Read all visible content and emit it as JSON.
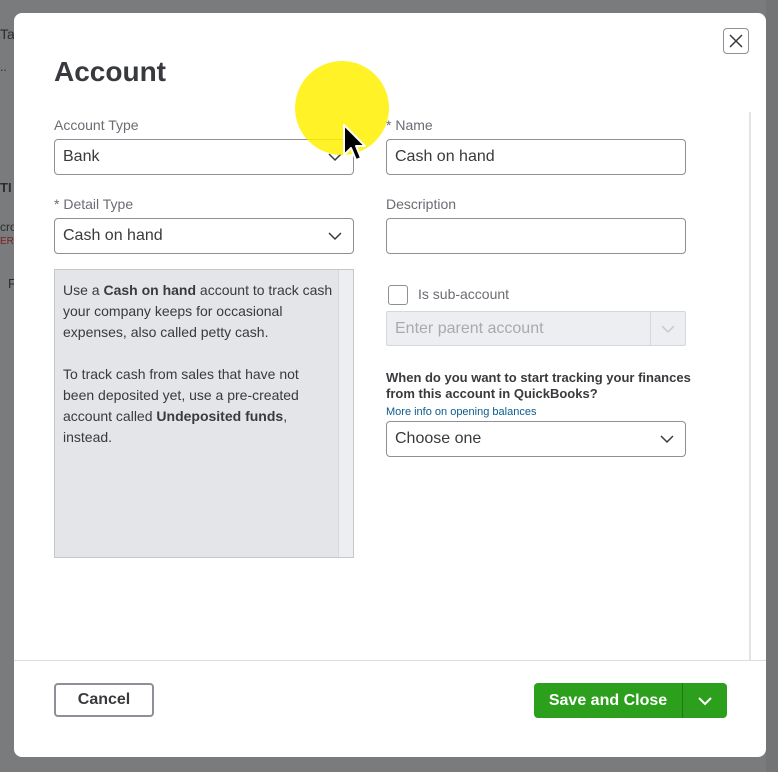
{
  "background": {
    "fragments": [
      "Ta",
      "..",
      "TI",
      "cro",
      "ERO",
      "F"
    ]
  },
  "modal": {
    "title": "Account",
    "close_icon": "close-icon",
    "account_type": {
      "label": "Account Type",
      "value": "Bank"
    },
    "detail_type": {
      "label": "* Detail Type",
      "value": "Cash on hand"
    },
    "name": {
      "label": "* Name",
      "value": "Cash on hand"
    },
    "description": {
      "label": "Description",
      "value": ""
    },
    "help": {
      "p1_pre": "Use a ",
      "p1_bold": "Cash on hand",
      "p1_post": " account to track cash your company keeps for occasional expenses, also called petty cash.",
      "p2_pre": "To track cash from sales that have not been deposited yet, use a pre-created account called ",
      "p2_bold": "Undeposited funds",
      "p2_post": ", instead."
    },
    "sub_account": {
      "label": "Is sub-account",
      "checked": false
    },
    "parent_account": {
      "placeholder": "Enter parent account"
    },
    "tracking": {
      "question": "When do you want to start tracking your finances from this account in QuickBooks?",
      "link": "More info on opening balances",
      "value": "Choose one"
    },
    "footer": {
      "cancel_label": "Cancel",
      "save_label": "Save and Close"
    }
  },
  "colors": {
    "accent_green": "#2ca01c",
    "link_blue": "#0a5c8d",
    "highlight_yellow": "#fff000"
  }
}
